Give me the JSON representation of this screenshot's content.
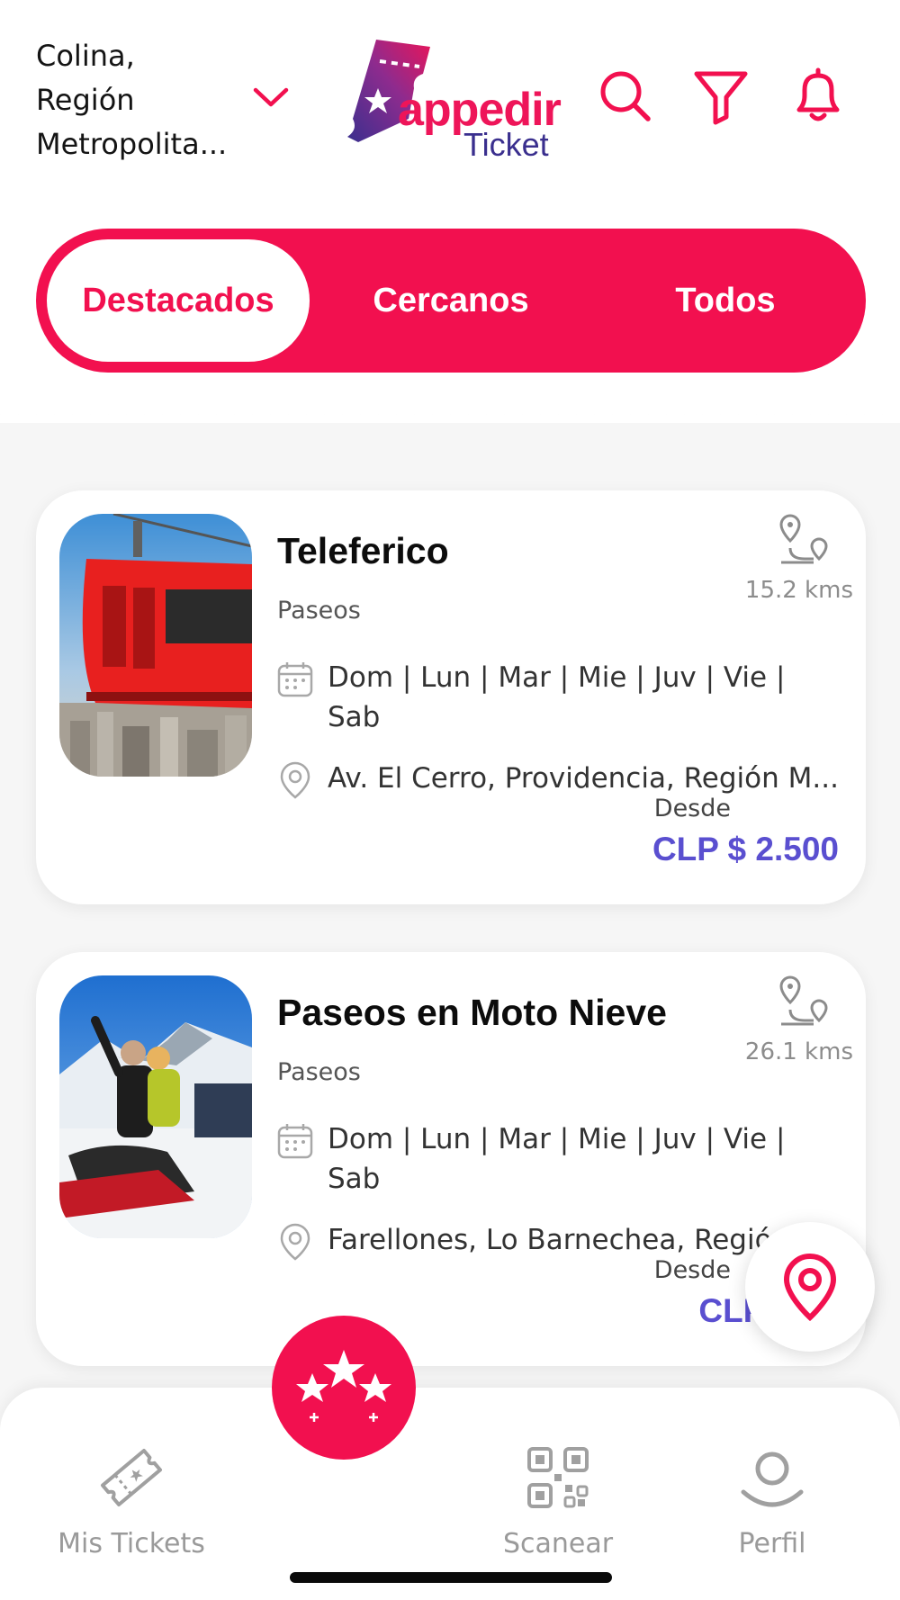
{
  "header": {
    "location_lines": [
      "Colina,",
      "Región",
      "Metropolita..."
    ],
    "logo": {
      "word": "appedir",
      "sub": "Ticket"
    }
  },
  "tabs": [
    {
      "label": "Destacados",
      "active": true
    },
    {
      "label": "Cercanos",
      "active": false
    },
    {
      "label": "Todos",
      "active": false
    }
  ],
  "events": [
    {
      "title": "Teleferico",
      "category": "Paseos",
      "distance": "15.2 kms",
      "days": "Dom | Lun | Mar | Mie | Juv | Vie | Sab",
      "address": "Av. El Cerro, Providencia, Región M...",
      "from_label": "Desde",
      "price": "CLP $ 2.500"
    },
    {
      "title": "Paseos en Moto Nieve",
      "category": "Paseos",
      "distance": "26.1 kms",
      "days": "Dom | Lun | Mar | Mie | Juv | Vie | Sab",
      "address": "Farellones, Lo Barnechea, Regió",
      "from_label": "Desde",
      "price": "CLP $ 25"
    }
  ],
  "bottom_nav": [
    {
      "label": "Mis Tickets",
      "icon": "ticket-icon"
    },
    {
      "label": "",
      "icon": "stars-icon"
    },
    {
      "label": "Scanear",
      "icon": "qr-code-icon"
    },
    {
      "label": "Perfil",
      "icon": "user-icon"
    }
  ],
  "colors": {
    "brand": "#f2104f",
    "price": "#5a4fd0",
    "logo_navy": "#3a2f8e"
  }
}
